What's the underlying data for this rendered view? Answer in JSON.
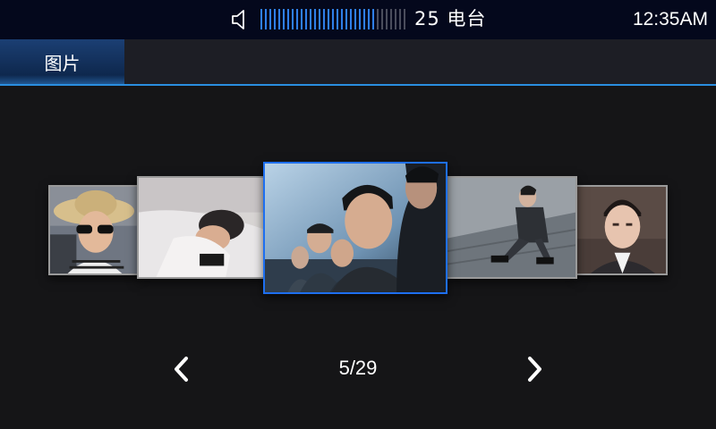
{
  "status_bar": {
    "speaker_icon": "speaker-icon",
    "volume": {
      "level": 0.8
    },
    "station": "25 电台",
    "clock": "12:35AM"
  },
  "tabs": [
    {
      "label": "图片",
      "selected": true
    }
  ],
  "gallery": {
    "page_indicator": "5/29",
    "current_index": 5,
    "total": 29,
    "thumbnails": [
      {
        "content": "photo",
        "selected": false
      },
      {
        "content": "photo",
        "selected": false
      },
      {
        "content": "photo",
        "selected": true
      },
      {
        "content": "photo",
        "selected": false
      },
      {
        "content": "photo",
        "selected": false
      }
    ],
    "prev_icon": "chevron-left-icon",
    "next_icon": "chevron-right-icon"
  },
  "colors": {
    "accent": "#2f7fe8",
    "status_bar_bg": "#04081c",
    "tab_active_bg": "#1b3f73",
    "page_bg": "#151517"
  }
}
